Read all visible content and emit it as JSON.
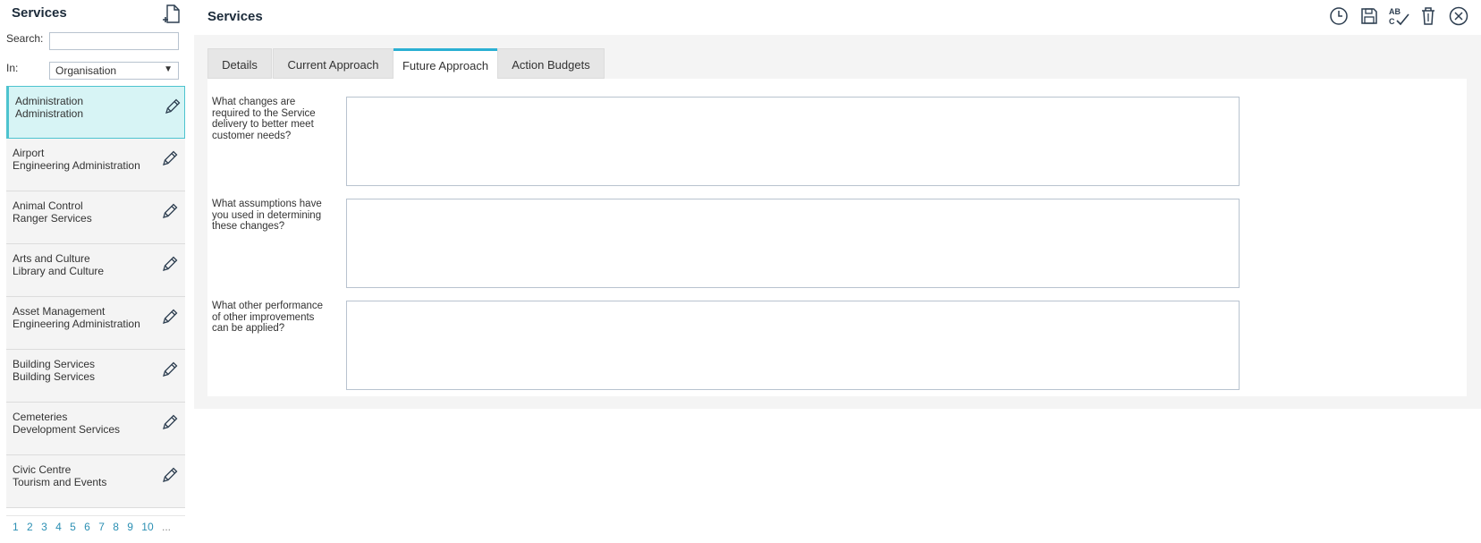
{
  "sidebar": {
    "title": "Services",
    "search_label": "Search:",
    "search_value": "",
    "in_label": "In:",
    "in_value": "Organisation",
    "items": [
      {
        "line1": "Administration",
        "line2": "Administration",
        "selected": true
      },
      {
        "line1": "Airport",
        "line2": "Engineering Administration"
      },
      {
        "line1": "Animal Control",
        "line2": "Ranger Services"
      },
      {
        "line1": "Arts and Culture",
        "line2": "Library and Culture"
      },
      {
        "line1": "Asset Management",
        "line2": "Engineering Administration"
      },
      {
        "line1": "Building Services",
        "line2": "Building Services"
      },
      {
        "line1": "Cemeteries",
        "line2": "Development Services"
      },
      {
        "line1": "Civic Centre",
        "line2": "Tourism and Events"
      }
    ],
    "pager": [
      "1",
      "2",
      "3",
      "4",
      "5",
      "6",
      "7",
      "8",
      "9",
      "10",
      "..."
    ]
  },
  "main": {
    "title": "Services",
    "toolbar": [
      "history-icon",
      "save-icon",
      "spellcheck-icon",
      "delete-icon",
      "close-icon"
    ],
    "tabs": [
      {
        "label": "Details"
      },
      {
        "label": "Current Approach"
      },
      {
        "label": "Future Approach",
        "active": true
      },
      {
        "label": "Action Budgets"
      }
    ],
    "questions": [
      {
        "label": "What changes are required to the Service delivery to better meet customer needs?",
        "value": ""
      },
      {
        "label": "What assumptions have you used in determining these changes?",
        "value": ""
      },
      {
        "label": "What other performance of other improvements can be applied?",
        "value": ""
      }
    ]
  },
  "colors": {
    "accent": "#2bb0d3",
    "selected_bg": "#d7f4f5",
    "selected_border": "#4dc3cf",
    "link": "#2b8fb3"
  }
}
